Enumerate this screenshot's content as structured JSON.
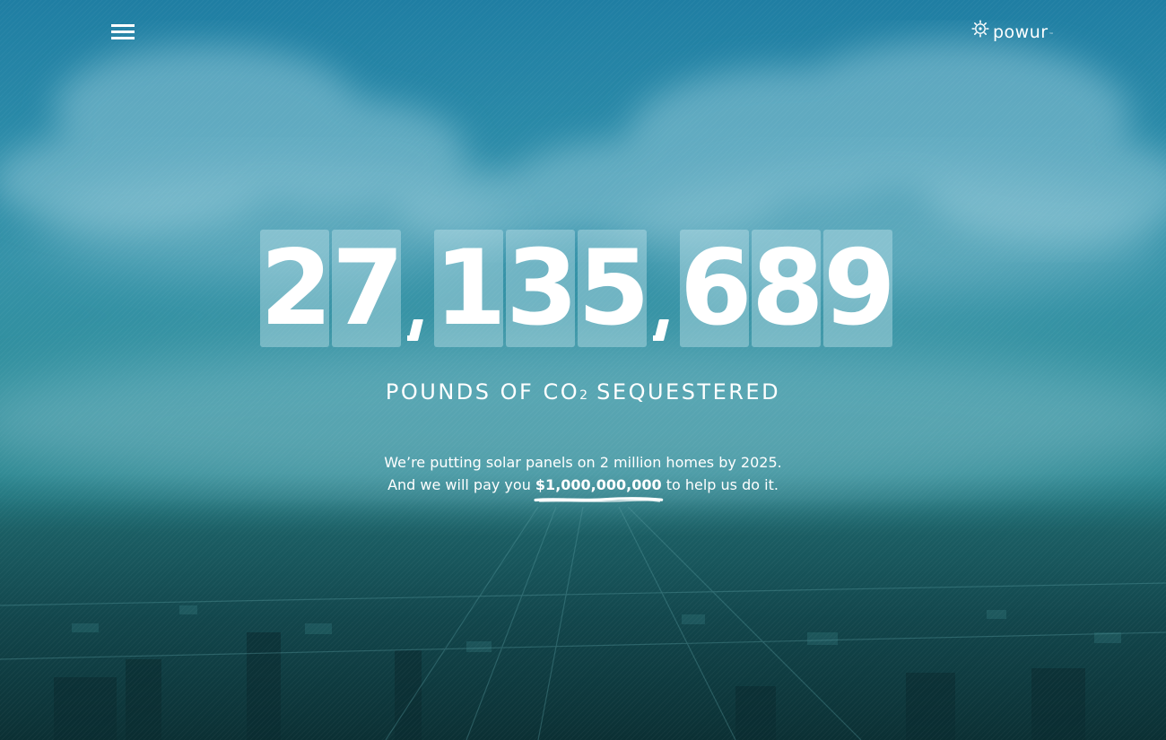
{
  "header": {
    "menu_icon": "hamburger-menu-icon",
    "logo_icon": "sun-gear-icon",
    "logo_text": "powur",
    "logo_tm": "™"
  },
  "counter": {
    "groups": [
      [
        "2",
        "7"
      ],
      [
        "1",
        "3",
        "5"
      ],
      [
        "6",
        "8",
        "9"
      ]
    ],
    "separator": ","
  },
  "caption": {
    "before": "POUNDS OF CO",
    "subscript": "2",
    "after": " SEQUESTERED"
  },
  "tagline": {
    "line1": "We’re putting solar panels on 2 million homes by 2025.",
    "line2_before": "And we will pay you ",
    "line2_highlight": "$1,000,000,000",
    "line2_after": " to help us do it."
  },
  "colors": {
    "sky_top": "#1f7ea3",
    "haze": "#2f8e9c",
    "city_dark": "#0e3a40",
    "digit_tile": "#c4e4ec",
    "text": "#ffffff"
  }
}
